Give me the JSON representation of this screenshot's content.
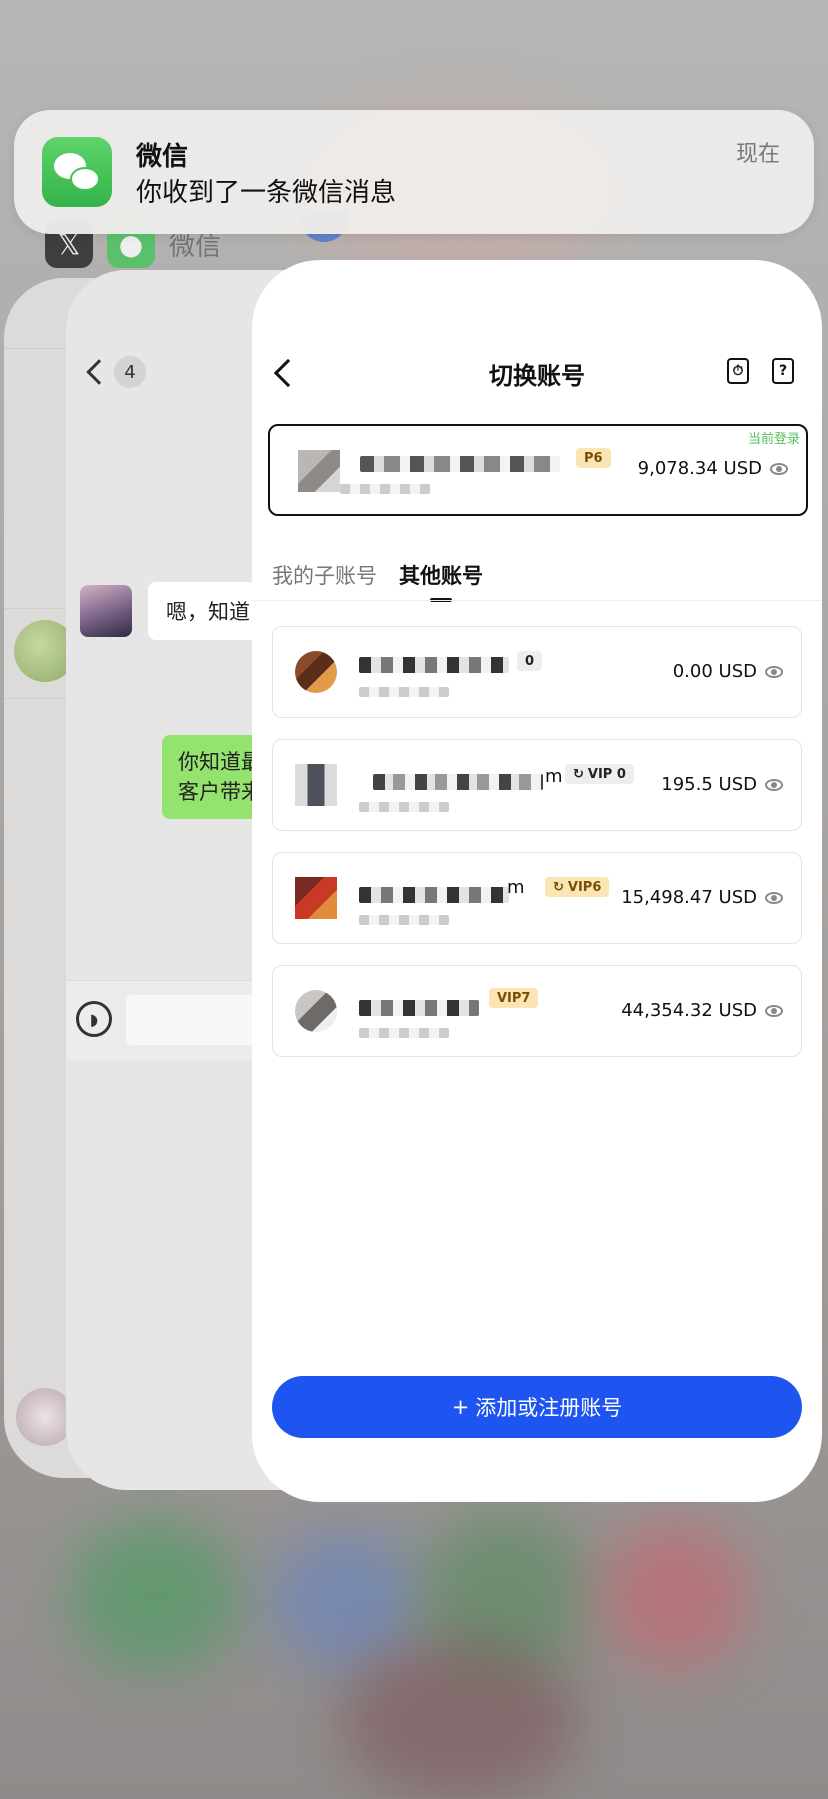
{
  "notification": {
    "app_name": "微信",
    "message": "你收到了一条微信消息",
    "time": "现在"
  },
  "background_app_label": "微信",
  "chat_preview": {
    "unread_count": "4",
    "incoming_message": "嗯，知道",
    "outgoing_message_line1": "你知道最",
    "outgoing_message_line2": "客户带来"
  },
  "account_switcher": {
    "title": "切换账号",
    "current_account": {
      "tag": "当前登录",
      "vip": "P6",
      "balance": "9,078.34 USD"
    },
    "tabs": [
      {
        "label": "我的子账号",
        "active": false
      },
      {
        "label": "其他账号",
        "active": true
      }
    ],
    "accounts": [
      {
        "vip": "0",
        "balance": "0.00 USD"
      },
      {
        "vip": "VIP 0",
        "balance": "195.5 USD",
        "suffix": "m"
      },
      {
        "vip": "VIP6",
        "balance": "15,498.47 USD",
        "suffix": "m"
      },
      {
        "vip": "VIP7",
        "balance": "44,354.32 USD",
        "suffix": ""
      }
    ],
    "add_button_icon": "+",
    "add_button": "添加或注册账号"
  },
  "colors": {
    "primary_button": "#1e54f0",
    "wechat_green": "#46c45b",
    "current_tag": "#57c05c",
    "vip_gold_bg": "#fbe5b5"
  },
  "icons": [
    "back-chevron-icon",
    "document-icon",
    "help-icon",
    "eye-icon",
    "wechat-icon",
    "voice-icon",
    "x-app-icon"
  ]
}
